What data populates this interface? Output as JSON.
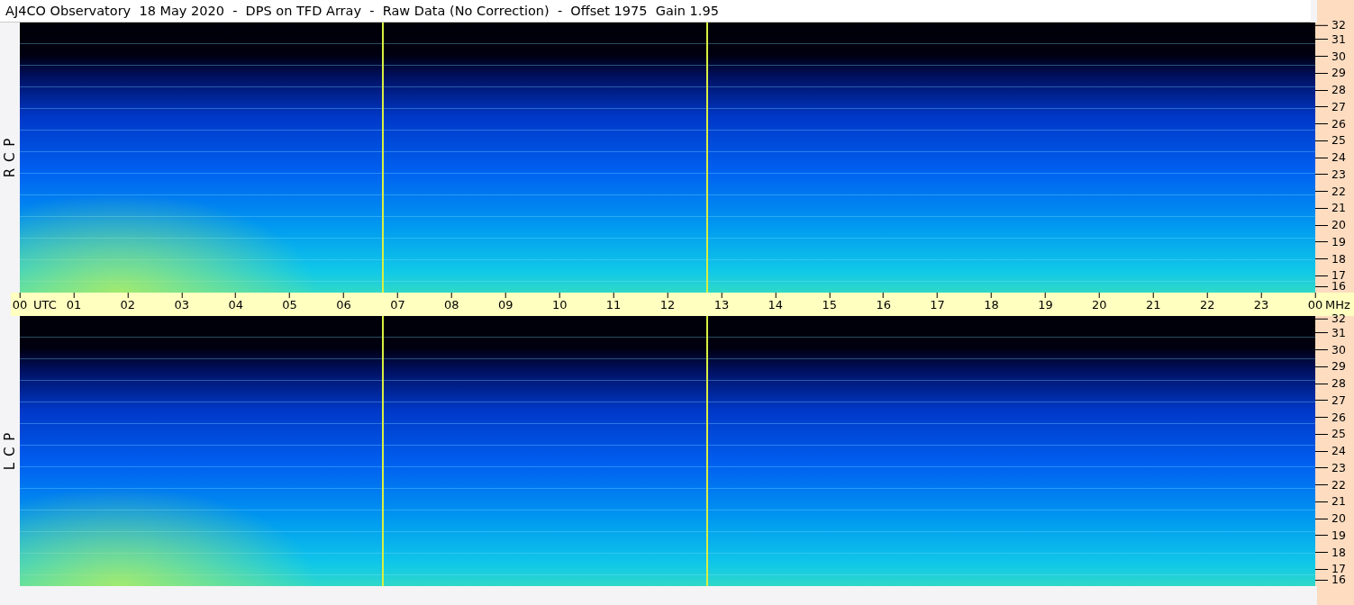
{
  "title": "AJ4CO Observatory  18 May 2020  -  DPS on TFD Array  -  Raw Data (No Correction)  -  Offset 1975  Gain 1.95",
  "panels": [
    {
      "label": "R C P",
      "frequency_ticks": [
        "32",
        "31",
        "30",
        "29",
        "28",
        "27",
        "26",
        "25",
        "24",
        "23",
        "22",
        "21",
        "20",
        "19",
        "18",
        "17",
        "16"
      ]
    },
    {
      "label": "L C P",
      "frequency_ticks": [
        "32",
        "31",
        "30",
        "29",
        "28",
        "27",
        "26",
        "25",
        "24",
        "23",
        "22",
        "21",
        "20",
        "19",
        "18",
        "17",
        "16"
      ]
    }
  ],
  "time_axis": {
    "start_unit": "UTC",
    "end_unit": "MHz",
    "ticks": [
      "00",
      "01",
      "02",
      "03",
      "04",
      "05",
      "06",
      "07",
      "08",
      "09",
      "10",
      "11",
      "12",
      "13",
      "14",
      "15",
      "16",
      "17",
      "18",
      "19",
      "20",
      "21",
      "22",
      "23",
      "00"
    ]
  }
}
